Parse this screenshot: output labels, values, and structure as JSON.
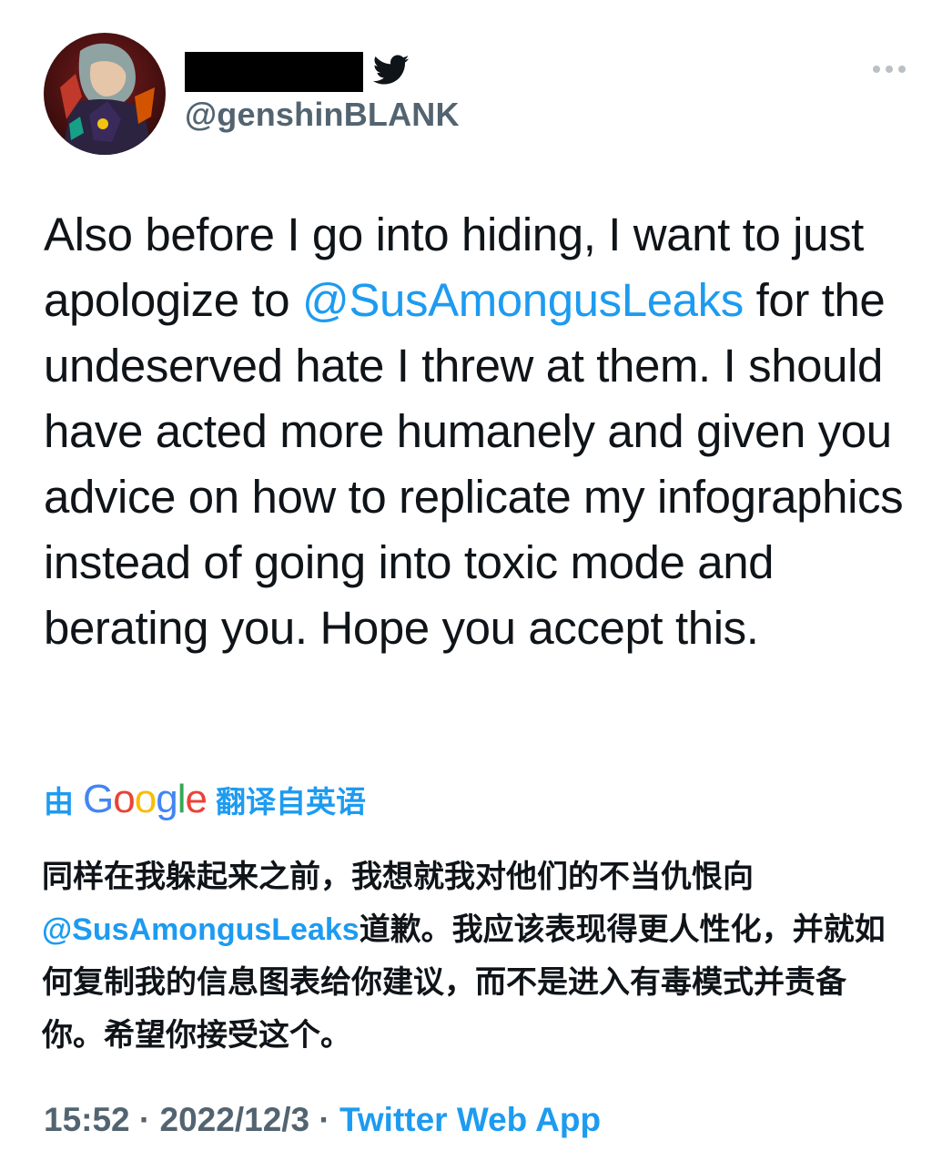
{
  "author": {
    "handle": "@genshinBLANK",
    "display_name_redacted": true,
    "avatar": "avatar-image",
    "badge_icon": "twitter-bird-icon"
  },
  "menu": {
    "icon": "more-icon",
    "label": "•••"
  },
  "tweet": {
    "text_before_mention": "Also before I go into hiding, I want to just apologize to ",
    "mention": "@SusAmongusLeaks",
    "text_after_mention": " for the undeserved hate I threw at them. I should have acted more humanely and given you advice on how to replicate my infographics instead of going into toxic mode and berating you. Hope you accept this."
  },
  "translation": {
    "by_label": "由",
    "google_letters": [
      "G",
      "o",
      "o",
      "g",
      "l",
      "e"
    ],
    "from_label": "翻译自英语",
    "text_line1": "同样在我躲起来之前，我想就我对他们的不当仇恨向",
    "mention": "@SusAmongusLeaks",
    "text_after_mention": "道歉。我应该表现得更人性化，并就如何复制我的信息图表给你建议，而不是进入有毒模式并责备你。希望你接受这个。"
  },
  "footer": {
    "time": "15:52",
    "separator": " · ",
    "date": "2022/12/3",
    "app": "Twitter Web App"
  },
  "colors": {
    "accent": "#1d9bf0",
    "text": "#0f1419",
    "secondary": "#536471"
  }
}
